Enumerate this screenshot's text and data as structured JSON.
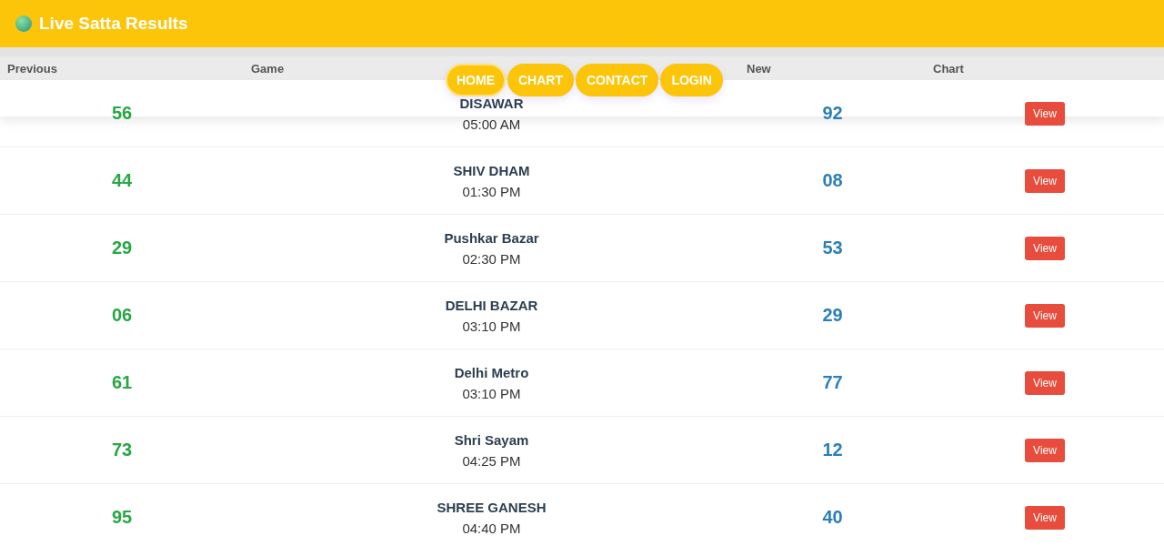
{
  "header": {
    "title": "Live Satta Results"
  },
  "nav": [
    {
      "label": "HOME",
      "selected": true
    },
    {
      "label": "CHART",
      "selected": false
    },
    {
      "label": "CONTACT",
      "selected": false
    },
    {
      "label": "LOGIN",
      "selected": false
    }
  ],
  "table": {
    "columns": [
      "Previous",
      "Game",
      "New",
      "Chart"
    ],
    "rows": [
      {
        "previous": "56",
        "game": "DISAWAR",
        "time": "05:00 AM",
        "new": "92",
        "action": "View"
      },
      {
        "previous": "44",
        "game": "SHIV DHAM",
        "time": "01:30 PM",
        "new": "08",
        "action": "View"
      },
      {
        "previous": "29",
        "game": "Pushkar Bazar",
        "time": "02:30 PM",
        "new": "53",
        "action": "View"
      },
      {
        "previous": "06",
        "game": "DELHI BAZAR",
        "time": "03:10 PM",
        "new": "29",
        "action": "View"
      },
      {
        "previous": "61",
        "game": "Delhi Metro",
        "time": "03:10 PM",
        "new": "77",
        "action": "View"
      },
      {
        "previous": "73",
        "game": "Shri Sayam",
        "time": "04:25 PM",
        "new": "12",
        "action": "View"
      },
      {
        "previous": "95",
        "game": "SHREE GANESH",
        "time": "04:40 PM",
        "new": "40",
        "action": "View"
      }
    ]
  }
}
